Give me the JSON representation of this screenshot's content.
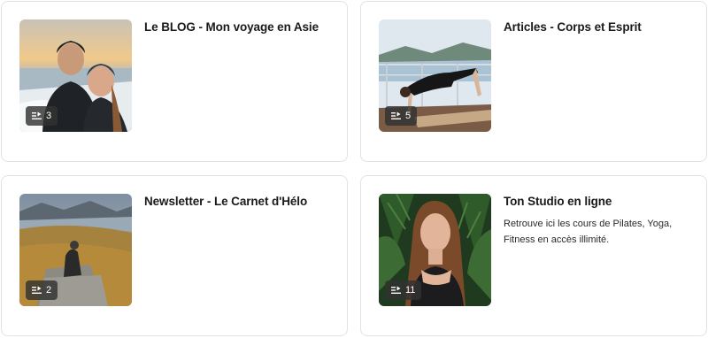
{
  "cards": [
    {
      "title": "Le BLOG - Mon voyage en Asie",
      "count": "3",
      "description": "",
      "image": "couple-selfie-sunset-lake"
    },
    {
      "title": "Articles - Corps et Esprit",
      "count": "5",
      "description": "",
      "image": "yoga-pose-lake-terrace"
    },
    {
      "title": "Newsletter - Le Carnet d'Hélo",
      "count": "2",
      "description": "",
      "image": "hikers-on-hill-fjord"
    },
    {
      "title": "Ton Studio en ligne",
      "count": "11",
      "description": "Retrouve ici les cours de Pilates, Yoga, Fitness en accès illimité.",
      "image": "woman-portrait-tropical-leaves"
    }
  ],
  "icons": {
    "badge": "playlist-icon"
  },
  "colors": {
    "badge_bg": "#323232",
    "card_border": "#e3e3e3",
    "text": "#1a1a1a"
  }
}
